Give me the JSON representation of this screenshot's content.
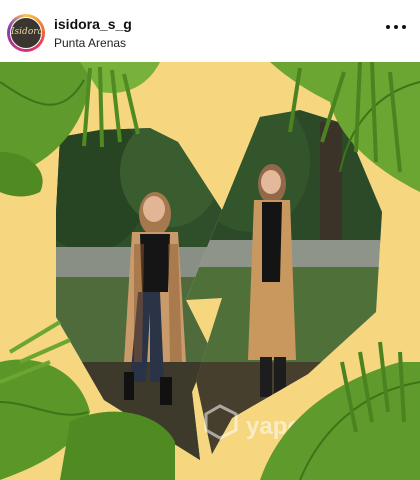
{
  "post": {
    "username": "isidora_s_g",
    "location": "Punta Arenas",
    "avatar_text": "Isidora",
    "more_icon": "more-options-icon"
  },
  "image": {
    "watermark": "yapo",
    "colors": {
      "background": "#f6d67e",
      "leaf": "#5f9a2c",
      "leaf_dark": "#3e7418",
      "leaf_light": "#8cc245"
    }
  }
}
